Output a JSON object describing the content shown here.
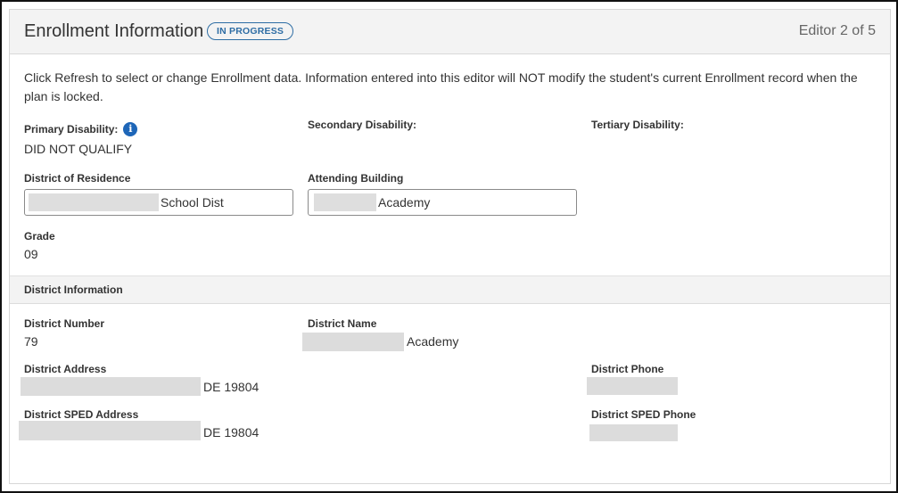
{
  "header": {
    "title": "Enrollment Information",
    "status": "IN PROGRESS",
    "editor_count": "Editor 2 of 5"
  },
  "instruction": "Click Refresh to select or change Enrollment data. Information entered into this editor will NOT modify the student's current Enrollment record when the plan is locked.",
  "disabilities": {
    "primary_label": "Primary Disability:",
    "primary_value": "DID NOT QUALIFY",
    "secondary_label": "Secondary Disability:",
    "tertiary_label": "Tertiary Disability:"
  },
  "fields": {
    "district_residence_label": "District of Residence",
    "district_residence_value": "School Dist",
    "attending_building_label": "Attending Building",
    "attending_building_value": "Academy",
    "grade_label": "Grade",
    "grade_value": "09"
  },
  "district_section": {
    "title": "District Information",
    "number_label": "District Number",
    "number_value": "79",
    "name_label": "District Name",
    "name_value": "Academy",
    "address_label": "District Address",
    "address_value": "DE 19804",
    "phone_label": "District Phone",
    "sped_address_label": "District SPED Address",
    "sped_address_value": "DE 19804",
    "sped_phone_label": "District SPED Phone"
  },
  "icons": {
    "info": "i"
  },
  "colors": {
    "accent": "#1e66b8",
    "badge": "#2e6da4"
  }
}
